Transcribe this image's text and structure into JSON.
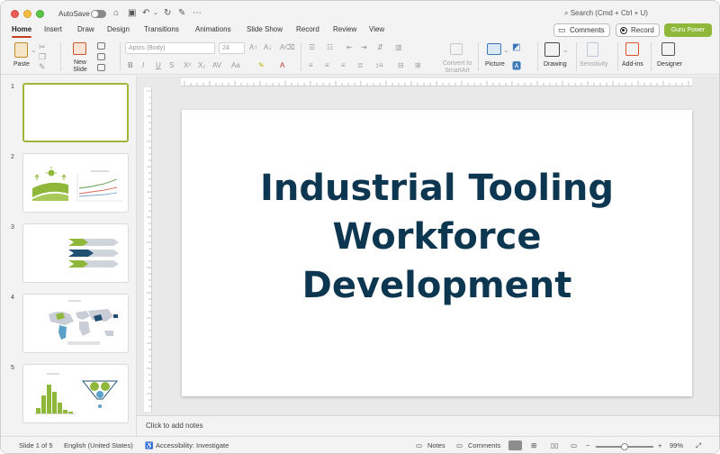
{
  "titlebar": {
    "autosave_label": "AutoSave",
    "search_placeholder": "Search (Cmd + Ctrl + U)"
  },
  "tabs": [
    "Home",
    "Insert",
    "Draw",
    "Design",
    "Transitions",
    "Animations",
    "Slide Show",
    "Record",
    "Review",
    "View"
  ],
  "active_tab": "Home",
  "header_buttons": {
    "comments": "Comments",
    "record": "Record",
    "guru": "Guru Power"
  },
  "ribbon": {
    "paste": "Paste",
    "new_slide": "New Slide",
    "font_name": "Aptos (Body)",
    "font_size": "24",
    "convert_smartart": "Convert to SmartArt",
    "picture": "Picture",
    "drawing": "Drawing",
    "sensitivity": "Sensitivity",
    "addins": "Add-ins",
    "designer": "Designer"
  },
  "slides": [
    {
      "number": "1"
    },
    {
      "number": "2"
    },
    {
      "number": "3"
    },
    {
      "number": "4"
    },
    {
      "number": "5"
    }
  ],
  "current_slide": {
    "title_lines": [
      "Industrial Tooling",
      "Workforce",
      "Development"
    ]
  },
  "notes_placeholder": "Click to add notes",
  "statusbar": {
    "slide_of": "Slide 1 of 5",
    "language": "English (United States)",
    "accessibility": "Accessibility: Investigate",
    "notes": "Notes",
    "comments": "Comments",
    "zoom": "99%",
    "zoom_fraction": 0.5
  },
  "colors": {
    "title_color": "#0d3650",
    "accent_green": "#8fb83b",
    "tab_underline": "#c43e1c"
  }
}
